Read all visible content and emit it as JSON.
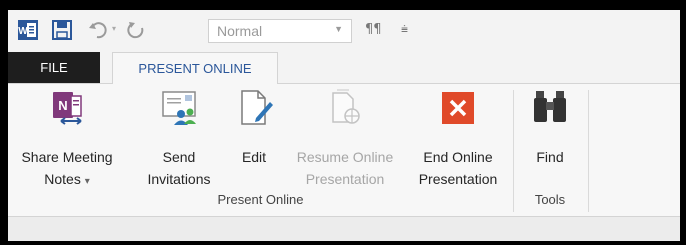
{
  "qat": {
    "style_value": "Normal",
    "word_icon": "word-app-icon",
    "save_icon": "save-icon",
    "undo_icon": "undo-icon",
    "redo_icon": "redo-icon",
    "para_icon": "paragraph-marks-icon",
    "more_icon": "customize-toolbar-icon"
  },
  "tabs": {
    "file": "FILE",
    "present_online": "PRESENT ONLINE"
  },
  "ribbon": {
    "buttons": [
      {
        "line1": "Share Meeting",
        "line2": "Notes",
        "dropdown": "▾",
        "icon": "onenote-share-icon"
      },
      {
        "line1": "Send",
        "line2": "Invitations",
        "icon": "send-invitations-icon"
      },
      {
        "line1": "Edit",
        "line2": "",
        "icon": "edit-document-icon"
      },
      {
        "line1": "Resume Online",
        "line2": "Presentation",
        "icon": "resume-presentation-icon",
        "disabled": true
      },
      {
        "line1": "End Online",
        "line2": "Presentation",
        "icon": "end-presentation-icon"
      },
      {
        "line1": "Find",
        "line2": "",
        "icon": "binoculars-icon"
      }
    ],
    "groups": {
      "present_online": "Present Online",
      "tools": "Tools"
    }
  },
  "colors": {
    "accent": "#2b579a",
    "onenote": "#80397b",
    "end_red": "#e04a2a"
  }
}
